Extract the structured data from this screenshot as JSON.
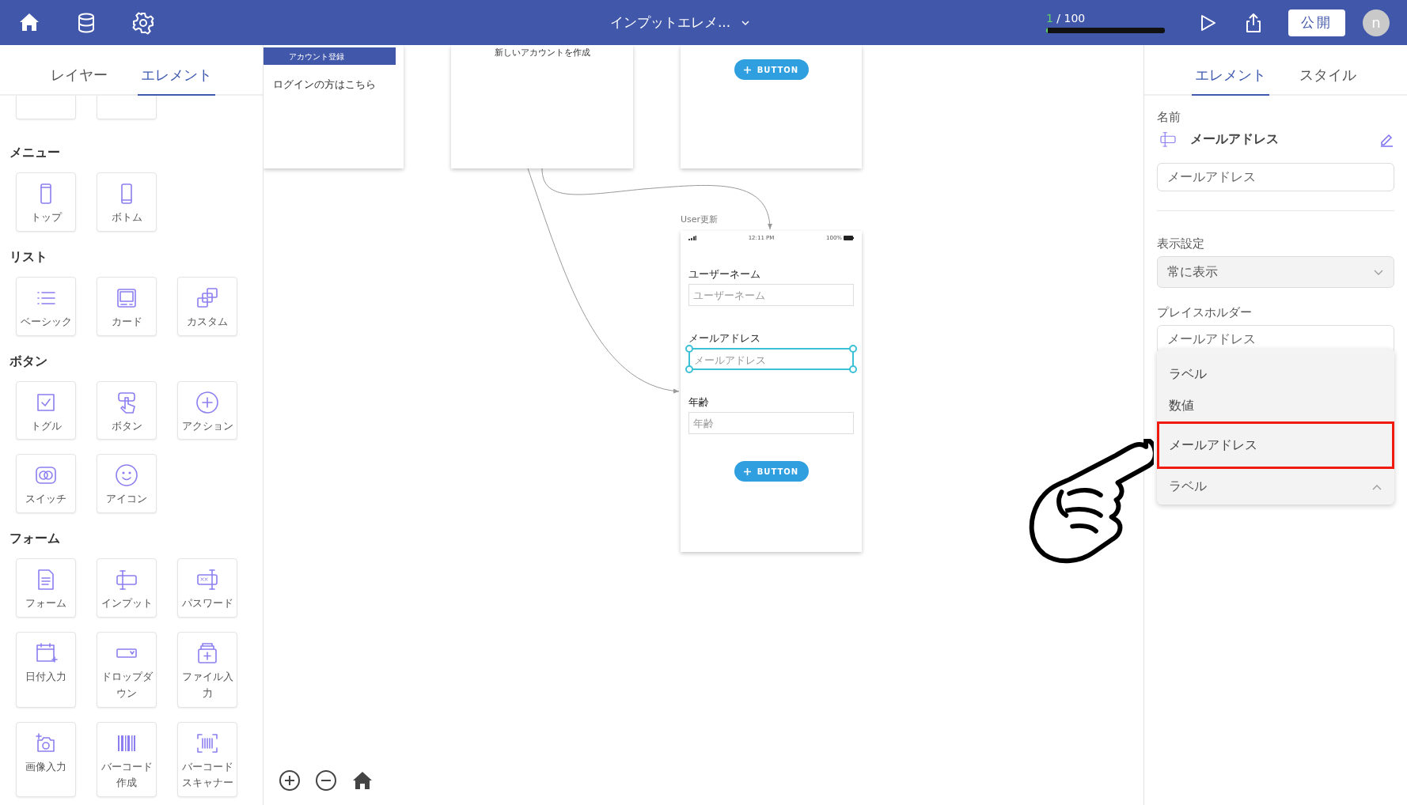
{
  "top_bar": {
    "title": "インプットエレメ...",
    "progress_current": "1",
    "progress_total": "/ 100",
    "level": 0.01,
    "publish_button": "公開",
    "avatar": "n"
  },
  "left_panel": {
    "tabs": [
      {
        "label": "レイヤー",
        "selected": false
      },
      {
        "label": "エレメント",
        "selected": true
      }
    ],
    "sections": [
      {
        "title": "メニュー",
        "items": [
          {
            "label": "トップ",
            "kind": "tablet"
          },
          {
            "label": "ボトム",
            "kind": "phone"
          }
        ]
      },
      {
        "title": "リスト",
        "items": [
          {
            "label": "ベーシック",
            "kind": "list"
          },
          {
            "label": "カード",
            "kind": "card"
          },
          {
            "label": "カスタム",
            "kind": "layers"
          }
        ]
      },
      {
        "title": "ボタン",
        "items": [
          {
            "label": "トグル",
            "kind": "checkbox"
          },
          {
            "label": "ボタン",
            "kind": "tap"
          },
          {
            "label": "アクション",
            "kind": "plus"
          },
          {
            "label": "スイッチ",
            "kind": "switch"
          },
          {
            "label": "アイコン",
            "kind": "smiley"
          }
        ]
      },
      {
        "title": "フォーム",
        "items": [
          {
            "label": "フォーム",
            "kind": "document"
          },
          {
            "label": "インプット",
            "kind": "input"
          },
          {
            "label": "パスワード",
            "kind": "password"
          },
          {
            "label": "日付入力",
            "kind": "calendar"
          },
          {
            "label": "ドロップダウン",
            "kind": "dropdown"
          },
          {
            "label": "ファイル入力",
            "kind": "file"
          },
          {
            "label": "画像入力",
            "kind": "camera"
          },
          {
            "label": "バーコード作成",
            "kind": "barcode"
          },
          {
            "label": "バーコードスキャナー",
            "kind": "scanner"
          }
        ]
      }
    ]
  },
  "canvas": {
    "screens": [
      {
        "kind": "header",
        "header": "アカウント登録",
        "text": "ログインの方はこちら"
      },
      {
        "kind": "text",
        "text": "新しいアカウントを作成"
      },
      {
        "kind": "button",
        "button": "BUTTON"
      }
    ],
    "phone": {
      "title": "User更新",
      "time": "12:11 PM",
      "battery": "100%",
      "fields": [
        {
          "label": "ユーザーネーム",
          "placeholder": "ユーザーネーム",
          "selected": false
        },
        {
          "label": "メールアドレス",
          "placeholder": "メールアドレス",
          "selected": true
        },
        {
          "label": "年齢",
          "placeholder": "年齢",
          "selected": false
        }
      ],
      "button": "BUTTON"
    }
  },
  "right_panel": {
    "tabs": [
      {
        "label": "エレメント",
        "selected": true
      },
      {
        "label": "スタイル",
        "selected": false
      }
    ],
    "name_label": "名前",
    "name": "メールアドレス",
    "name_field": "メールアドレス",
    "display_label": "表示設定",
    "display_select": "常に表示",
    "placeholder_label": "プレイスホルダー",
    "placeholder_field": "メールアドレス",
    "dropdown": {
      "options": [
        {
          "label": "ラベル",
          "highlighted": false
        },
        {
          "label": "数値",
          "highlighted": false
        },
        {
          "label": "メールアドレス",
          "highlighted": true
        }
      ],
      "current": "ラベル"
    }
  }
}
